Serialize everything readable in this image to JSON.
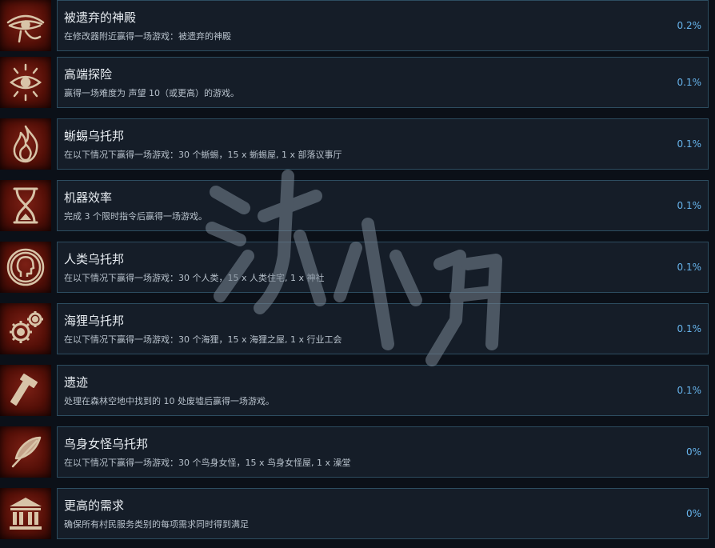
{
  "colors": {
    "background": "#0b1018",
    "panel": "#151d28",
    "panel_border": "#2d4d60",
    "title": "#e8edf2",
    "desc": "#b7c1cb",
    "percent": "#67b4ec",
    "icon_bg": "#6b1a10",
    "icon_fg": "#d8c4a8"
  },
  "achievements": [
    {
      "icon": "eye-of-horus-icon",
      "title": "被遗弃的神殿",
      "desc": "在修改器附近赢得一场游戏：被遗弃的神殿",
      "percent": "0.2%"
    },
    {
      "icon": "sun-eye-icon",
      "title": "高端探险",
      "desc": "赢得一场难度为 声望 10（或更高）的游戏。",
      "percent": "0.1%"
    },
    {
      "icon": "flame-icon",
      "title": "蜥蜴乌托邦",
      "desc": "在以下情况下赢得一场游戏：30 个蜥蜴，15 x 蜥蜴屋, 1 x 部落议事厅",
      "percent": "0.1%"
    },
    {
      "icon": "hourglass-icon",
      "title": "机器效率",
      "desc": "完成 3 个限时指令后赢得一场游戏。",
      "percent": "0.1%"
    },
    {
      "icon": "human-head-icon",
      "title": "人类乌托邦",
      "desc": "在以下情况下赢得一场游戏：30 个人类，15 x 人类住宅, 1 x 神社",
      "percent": "0.1%"
    },
    {
      "icon": "gears-icon",
      "title": "海狸乌托邦",
      "desc": "在以下情况下赢得一场游戏：30 个海狸，15 x 海狸之屋, 1 x 行业工会",
      "percent": "0.1%"
    },
    {
      "icon": "hammer-icon",
      "title": "遗迹",
      "desc": "处理在森林空地中找到的 10 处废墟后赢得一场游戏。",
      "percent": "0.1%"
    },
    {
      "icon": "feather-icon",
      "title": "鸟身女怪乌托邦",
      "desc": "在以下情况下赢得一场游戏：30 个鸟身女怪，15 x 鸟身女怪屋, 1 x 澡堂",
      "percent": "0%"
    },
    {
      "icon": "temple-icon",
      "title": "更高的需求",
      "desc": "确保所有村民服务类别的每项需求同时得到满足",
      "percent": "0%"
    }
  ]
}
